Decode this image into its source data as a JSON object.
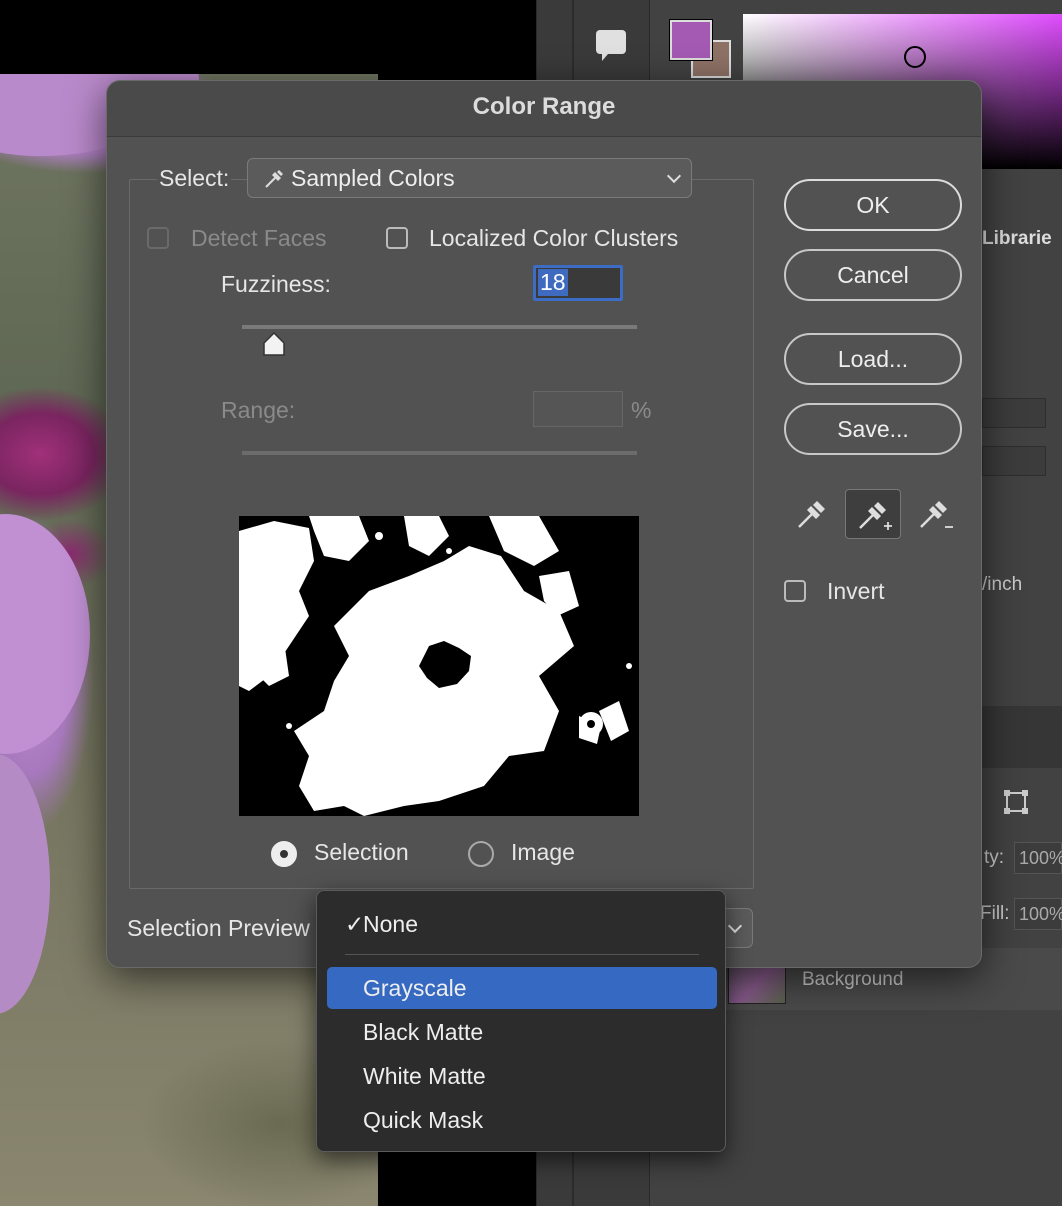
{
  "dialog": {
    "title": "Color Range",
    "select_label": "Select:",
    "select_value": "Sampled Colors",
    "detect_faces_label": "Detect Faces",
    "localized_label": "Localized Color Clusters",
    "fuzziness_label": "Fuzziness:",
    "fuzziness_value": "18",
    "fuzziness_slider_fraction": 0.08,
    "range_label": "Range:",
    "range_unit": "%",
    "radio_selection_label": "Selection",
    "radio_image_label": "Image",
    "selection_preview_label": "Selection Preview",
    "buttons": {
      "ok": "OK",
      "cancel": "Cancel",
      "load": "Load...",
      "save": "Save..."
    },
    "invert_label": "Invert"
  },
  "preview_menu": {
    "items": [
      "None",
      "Grayscale",
      "Black Matte",
      "White Matte",
      "Quick Mask"
    ],
    "checked": "None",
    "highlighted": "Grayscale"
  },
  "right_panel": {
    "tab_label": "Librarie",
    "resolution_unit": "/inch",
    "opacity_label": "ty:",
    "opacity_value": "100%",
    "fill_label": "Fill:",
    "fill_value": "100%",
    "layer_name": "Background",
    "foreground_color": "#a45ab2",
    "background_color": "#8f7266"
  },
  "colors": {
    "dialog_bg": "#525252",
    "highlight": "#3569c2",
    "menu_bg": "#2c2c2c"
  }
}
